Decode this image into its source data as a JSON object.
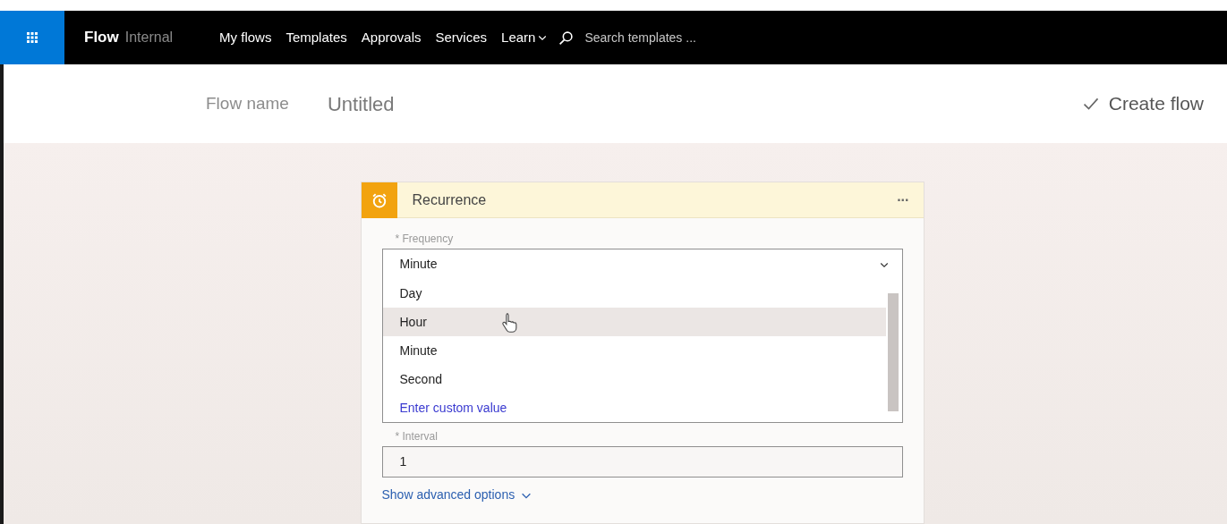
{
  "nav": {
    "brand": "Flow",
    "environment": "Internal",
    "links": [
      {
        "label": "My flows",
        "dropdown": false
      },
      {
        "label": "Templates",
        "dropdown": false
      },
      {
        "label": "Approvals",
        "dropdown": false
      },
      {
        "label": "Services",
        "dropdown": false
      },
      {
        "label": "Learn",
        "dropdown": true
      }
    ],
    "search": {
      "placeholder": "Search templates ..."
    }
  },
  "header": {
    "name_label": "Flow name",
    "name_value": "Untitled",
    "create_button": "Create flow"
  },
  "card": {
    "title": "Recurrence",
    "menu": "...",
    "frequency": {
      "label": "* Frequency",
      "value": "Minute",
      "options": [
        {
          "label": "Day",
          "kind": "option",
          "highlighted": false
        },
        {
          "label": "Hour",
          "kind": "option",
          "highlighted": true
        },
        {
          "label": "Minute",
          "kind": "option",
          "highlighted": false
        },
        {
          "label": "Second",
          "kind": "option",
          "highlighted": false
        },
        {
          "label": "Enter custom value",
          "kind": "link",
          "highlighted": false
        }
      ]
    },
    "interval": {
      "label": "* Interval",
      "value": "1"
    },
    "advanced_link": "Show advanced options"
  }
}
